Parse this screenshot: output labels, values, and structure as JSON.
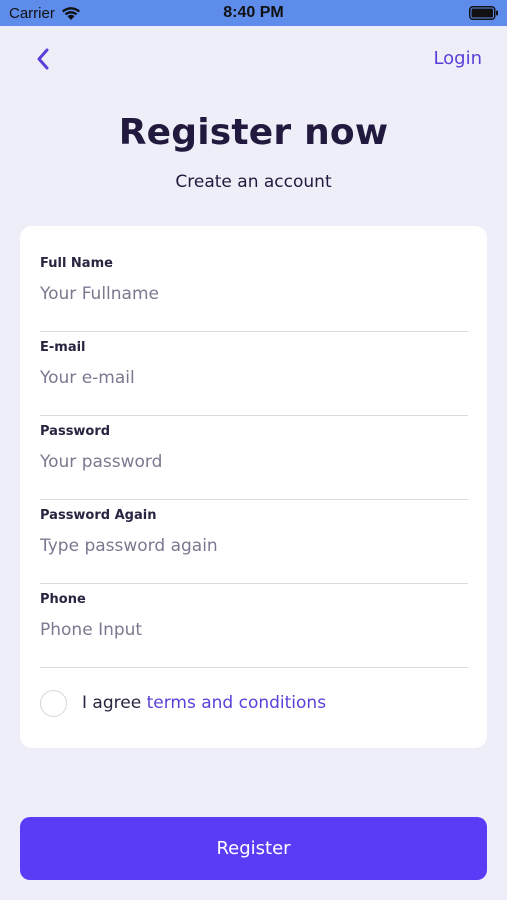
{
  "status_bar": {
    "carrier": "Carrier",
    "time": "8:40 PM",
    "wifi_icon": "wifi-icon",
    "battery_icon": "battery-full-icon"
  },
  "header": {
    "back_icon": "chevron-left-icon",
    "login_label": "Login",
    "title": "Register now",
    "subtitle": "Create an account"
  },
  "form": {
    "fields": [
      {
        "label": "Full Name",
        "placeholder": "Your Fullname",
        "value": ""
      },
      {
        "label": "E-mail",
        "placeholder": "Your e-mail",
        "value": ""
      },
      {
        "label": "Password",
        "placeholder": "Your password",
        "value": ""
      },
      {
        "label": "Password Again",
        "placeholder": "Type password again",
        "value": ""
      },
      {
        "label": "Phone",
        "placeholder": "Phone Input",
        "value": ""
      }
    ],
    "agree_prefix": "I agree",
    "terms_label": "terms and conditions",
    "agree_checked": false
  },
  "register_label": "Register",
  "colors": {
    "accent": "#5B3CF6",
    "link": "#5B3FD9",
    "background": "#EEEEF8",
    "status_bar": "#5E8CEB",
    "title_text": "#211A3E"
  }
}
